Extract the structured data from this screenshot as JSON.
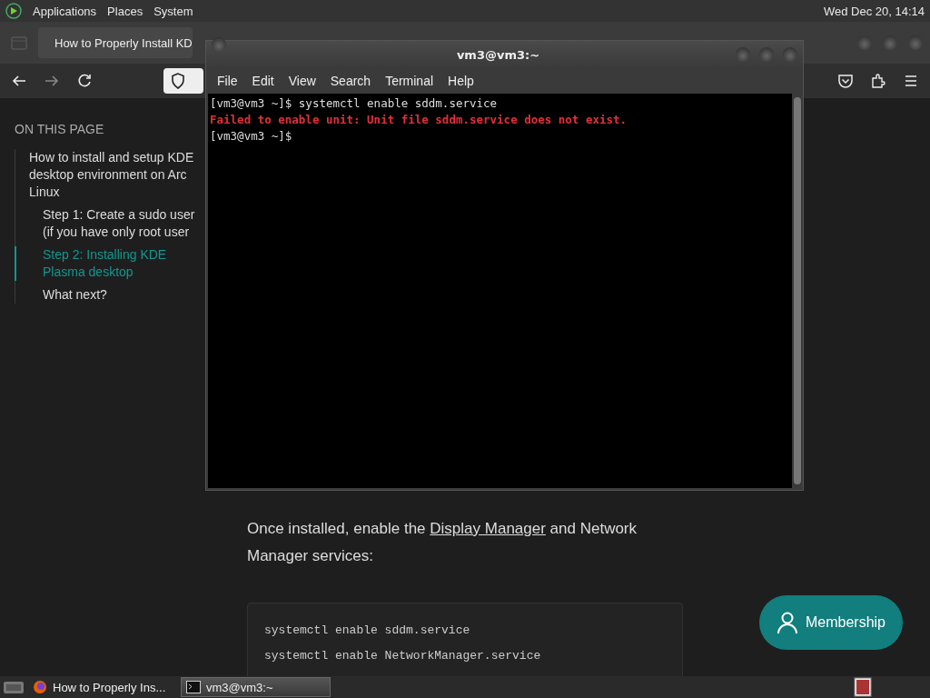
{
  "top_panel": {
    "menus": [
      "Applications",
      "Places",
      "System"
    ],
    "clock": "Wed Dec 20, 14:14"
  },
  "browser": {
    "tab": {
      "title": "How to Properly Install KD"
    },
    "toc": {
      "heading": "ON THIS PAGE",
      "items": [
        {
          "text": "How to install and setup KDE desktop environment on Arc Linux",
          "selected": false,
          "children": [
            {
              "text": "Step 1: Create a sudo user (if you have only root user",
              "selected": false
            },
            {
              "text": "Step 2: Installing KDE Plasma desktop",
              "selected": true
            },
            {
              "text": "What next?",
              "selected": false
            }
          ]
        }
      ]
    },
    "article": {
      "paragraph": {
        "before": "Once installed, enable the ",
        "link": "Display Manager",
        "after": " and Network Manager services:"
      },
      "code_lines": [
        "systemctl enable sddm.service",
        "systemctl enable NetworkManager.service"
      ]
    },
    "membership_button": "Membership"
  },
  "terminal": {
    "title": "vm3@vm3:~",
    "menu": [
      "File",
      "Edit",
      "View",
      "Search",
      "Terminal",
      "Help"
    ],
    "lines": [
      {
        "kind": "command",
        "text": "[vm3@vm3 ~]$ systemctl enable sddm.service"
      },
      {
        "kind": "error",
        "text": "Failed to enable unit: Unit file sddm.service does not exist."
      },
      {
        "kind": "command",
        "text": "[vm3@vm3 ~]$"
      }
    ]
  },
  "taskbar": {
    "items": [
      {
        "kind": "browser",
        "label": "How to Properly Ins...",
        "selected": false
      },
      {
        "kind": "terminal",
        "label": "vm3@vm3:~",
        "selected": true
      }
    ]
  }
}
